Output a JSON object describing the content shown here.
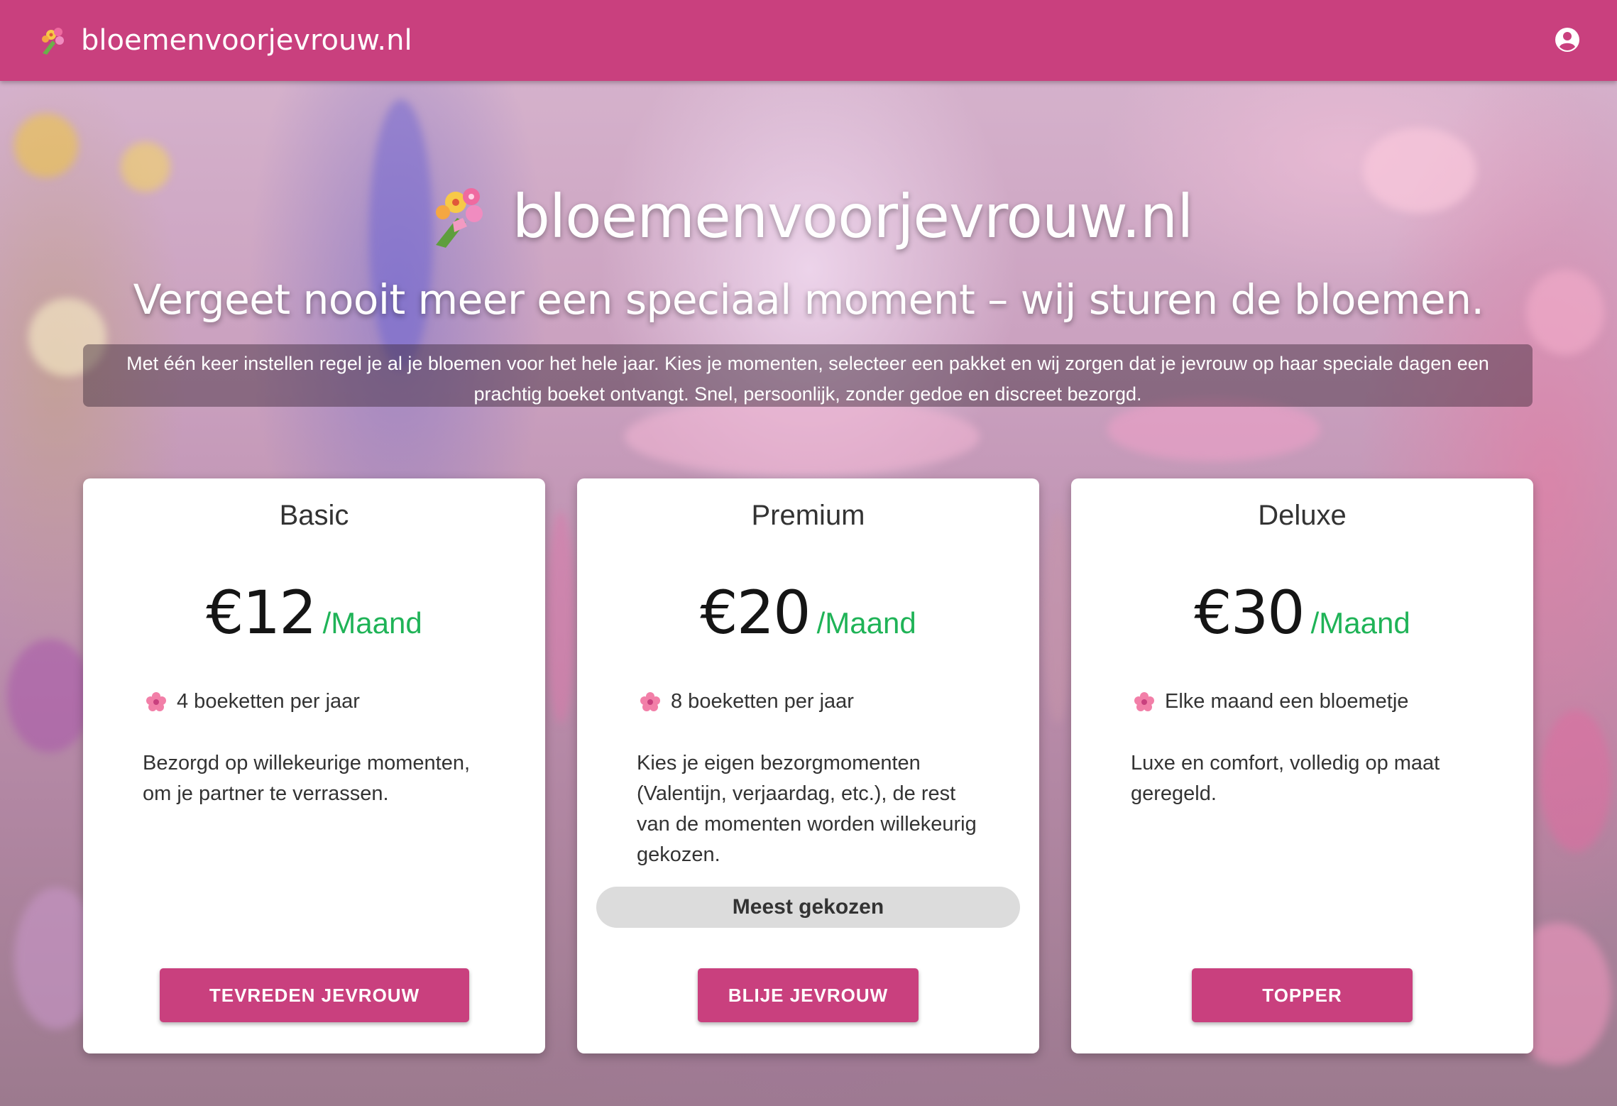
{
  "appbar": {
    "brand": "bloemenvoorjevrouw.nl",
    "logo_icon": "bouquet-icon",
    "account_icon": "account-circle-icon",
    "color": "#c9407e"
  },
  "hero": {
    "title": "bloemenvoorjevrouw.nl",
    "subtitle": "Vergeet nooit meer een speciaal moment – wij sturen de bloemen.",
    "description": "Met één keer instellen regel je al je bloemen voor het hele jaar. Kies je momenten, selecteer een pakket en wij zorgen dat je jevrouw op haar speciale dagen een prachtig boeket ontvangt. Snel, persoonlijk, zonder gedoe en discreet bezorgd."
  },
  "plans": [
    {
      "name": "Basic",
      "price": "€12",
      "period": "/Maand",
      "feature": "4 boeketten per jaar",
      "feature_icon": "cherry-blossom-icon",
      "description": "Bezorgd op willekeurige momenten, om je partner te verrassen.",
      "cta": "TEVREDEN JEVROUW"
    },
    {
      "name": "Premium",
      "price": "€20",
      "period": "/Maand",
      "feature": "8 boeketten per jaar",
      "feature_icon": "cherry-blossom-icon",
      "description": "Kies je eigen bezorgmomenten (Valentijn, verjaardag, etc.), de rest van de momenten worden willekeurig gekozen.",
      "badge": "Meest gekozen",
      "cta": "BLIJE JEVROUW"
    },
    {
      "name": "Deluxe",
      "price": "€30",
      "period": "/Maand",
      "feature": "Elke maand een bloemetje",
      "feature_icon": "cherry-blossom-icon",
      "description": "Luxe en comfort, volledig op maat geregeld.",
      "cta": "TOPPER"
    }
  ],
  "colors": {
    "accent": "#c9407e",
    "price_period": "#1fb357",
    "badge_bg": "#dcdcdc"
  }
}
